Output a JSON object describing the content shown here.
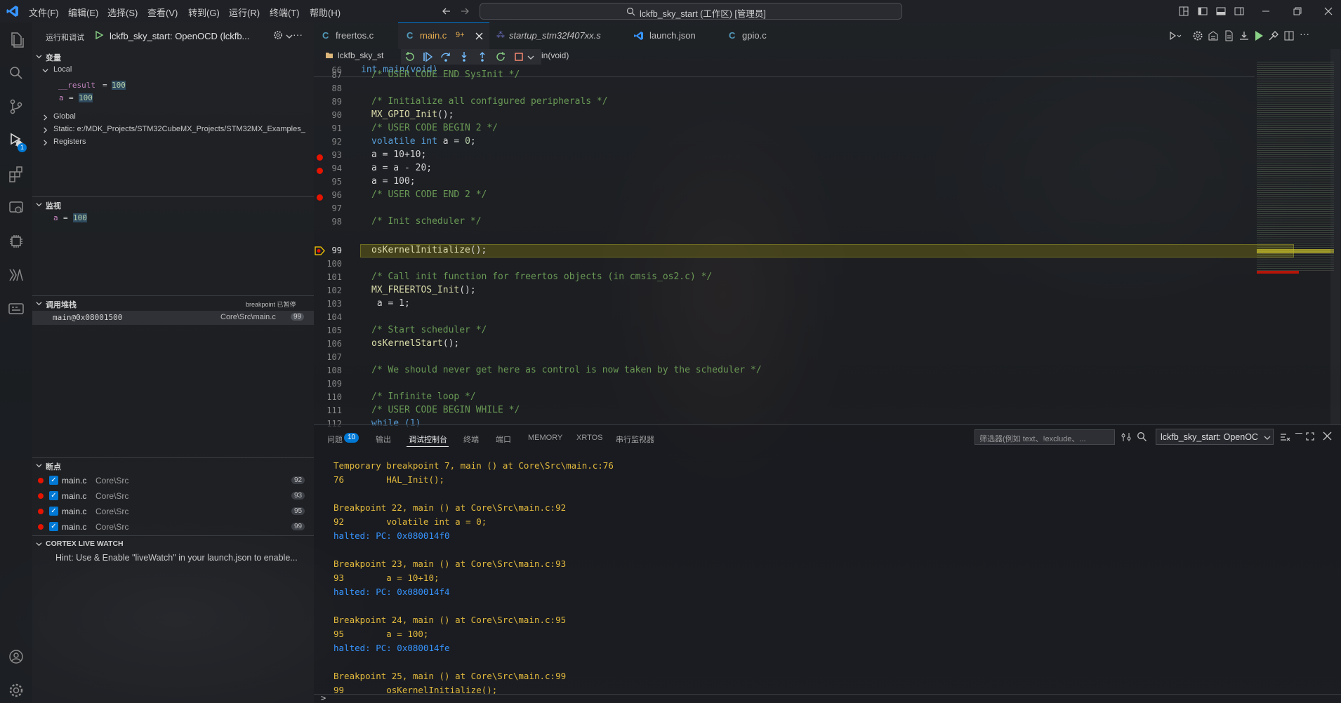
{
  "menus": [
    "文件(F)",
    "编辑(E)",
    "选择(S)",
    "查看(V)",
    "转到(G)",
    "运行(R)",
    "终端(T)",
    "帮助(H)"
  ],
  "window_title": "lckfb_sky_start (工作区) [管理员]",
  "sidebar": {
    "title": "运行和调试",
    "config": "lckfb_sky_start: OpenOCD (lckfb...",
    "vars_header": "变量",
    "local_label": "Local",
    "local_vars": [
      {
        "name": "__result",
        "value": "100"
      },
      {
        "name": "a",
        "value": "100"
      }
    ],
    "global_label": "Global",
    "static_label": "Static: e:/MDK_Projects/STM32CubeMX_Projects/STM32MX_Examples_",
    "registers_label": "Registers",
    "watch_header": "监视",
    "watch": [
      {
        "name": "a",
        "value": "100"
      }
    ],
    "callstack_header": "调用堆栈",
    "callstack_status": "breakpoint 已暂停",
    "callstack_frame": {
      "fn": "main@0x08001500",
      "file": "Core\\Src\\main.c",
      "line": "99"
    },
    "breakpoints_header": "断点",
    "breakpoints": [
      {
        "file": "main.c",
        "path": "Core\\Src",
        "line": "92"
      },
      {
        "file": "main.c",
        "path": "Core\\Src",
        "line": "93"
      },
      {
        "file": "main.c",
        "path": "Core\\Src",
        "line": "95"
      },
      {
        "file": "main.c",
        "path": "Core\\Src",
        "line": "99"
      }
    ],
    "livewatch_header": "CORTEX LIVE WATCH",
    "livewatch_hint": "Hint: Use & Enable \"liveWatch\" in your launch.json to enable..."
  },
  "tabs": [
    {
      "label": "freertos.c"
    },
    {
      "label": "main.c",
      "badge": "9+"
    },
    {
      "label": "startup_stm32f407xx.s"
    },
    {
      "label": "launch.json"
    },
    {
      "label": "gpio.c"
    }
  ],
  "breadcrumb": {
    "folder": "lckfb_sky_st",
    "symbol": "in(void)"
  },
  "code": {
    "l66": "66",
    "l66t": "int main(void)",
    "l87": "87",
    "l87t": "/* USER CODE END SysInit */",
    "l88": "88",
    "l89": "89",
    "l89t": "/* Initialize all configured peripherals */",
    "l90": "90",
    "l90t": "MX_GPIO_Init",
    "l91": "91",
    "l91t": "/* USER CODE BEGIN 2 */",
    "l92": "92",
    "l92a": "volatile",
    "l92b": "int",
    "l92c": " a = ",
    "l92d": "0",
    "l93": "93",
    "l93t": "a = 10+10;",
    "l94": "94",
    "l94t": "a = a - 20;",
    "l95": "95",
    "l95t": "a = 100;",
    "l96": "96",
    "l96t": "/* USER CODE END 2 */",
    "l97": "97",
    "l98": "98",
    "l98t": "/* Init scheduler */",
    "l99": "99",
    "l99t": "osKernelInitialize",
    "l100": "100",
    "l101": "101",
    "l101t": "/* Call init function for freertos objects (in cmsis_os2.c) */",
    "l102": "102",
    "l102t": "MX_FREERTOS_Init",
    "l103": "103",
    "l103t": " a = 1;",
    "l104": "104",
    "l105": "105",
    "l105t": "/* Start scheduler */",
    "l106": "106",
    "l106t": "osKernelStart",
    "l107": "107",
    "l108": "108",
    "l108t": "/* We should never get here as control is now taken by the scheduler */",
    "l109": "109",
    "l110": "110",
    "l110t": "/* Infinite loop */",
    "l111": "111",
    "l111t": "/* USER CODE BEGIN WHILE */",
    "l112": "112",
    "l112t": "while (1)",
    "call_suffix": "();"
  },
  "panel": {
    "tabs": {
      "problems": "问题",
      "problems_count": "10",
      "output": "输出",
      "debug_console": "调试控制台",
      "terminal": "终端",
      "ports": "端口",
      "memory": "MEMORY",
      "xrtos": "XRTOS",
      "serial": "串行监视器"
    },
    "filter_placeholder": "筛选器(例如 text、!exclude、...",
    "session": "lckfb_sky_start: OpenOC",
    "console": [
      {
        "t": "Temporary breakpoint 7, main () at Core\\Src\\main.c:76",
        "c": "y"
      },
      {
        "t": "76        HAL_Init();",
        "c": "y"
      },
      {
        "t": "Breakpoint 22, main () at Core\\Src\\main.c:92",
        "c": "y"
      },
      {
        "t": "92        volatile int a = 0;",
        "c": "y"
      },
      {
        "t": "halted: PC: 0x080014f0",
        "c": "b"
      },
      {
        "t": "Breakpoint 23, main () at Core\\Src\\main.c:93",
        "c": "y"
      },
      {
        "t": "93        a = 10+10;",
        "c": "y"
      },
      {
        "t": "halted: PC: 0x080014f4",
        "c": "b"
      },
      {
        "t": "Breakpoint 24, main () at Core\\Src\\main.c:95",
        "c": "y"
      },
      {
        "t": "95        a = 100;",
        "c": "y"
      },
      {
        "t": "halted: PC: 0x080014fe",
        "c": "b"
      },
      {
        "t": "Breakpoint 25, main () at Core\\Src\\main.c:99",
        "c": "y"
      },
      {
        "t": "99        osKernelInitialize();",
        "c": "y"
      }
    ],
    "prompt": ">"
  },
  "colors": {
    "accent": "#0078d4",
    "breakpoint": "#e51400",
    "current_line": "#4b4a14",
    "console_text": "#e2b93d",
    "console_info": "#3794ff"
  }
}
